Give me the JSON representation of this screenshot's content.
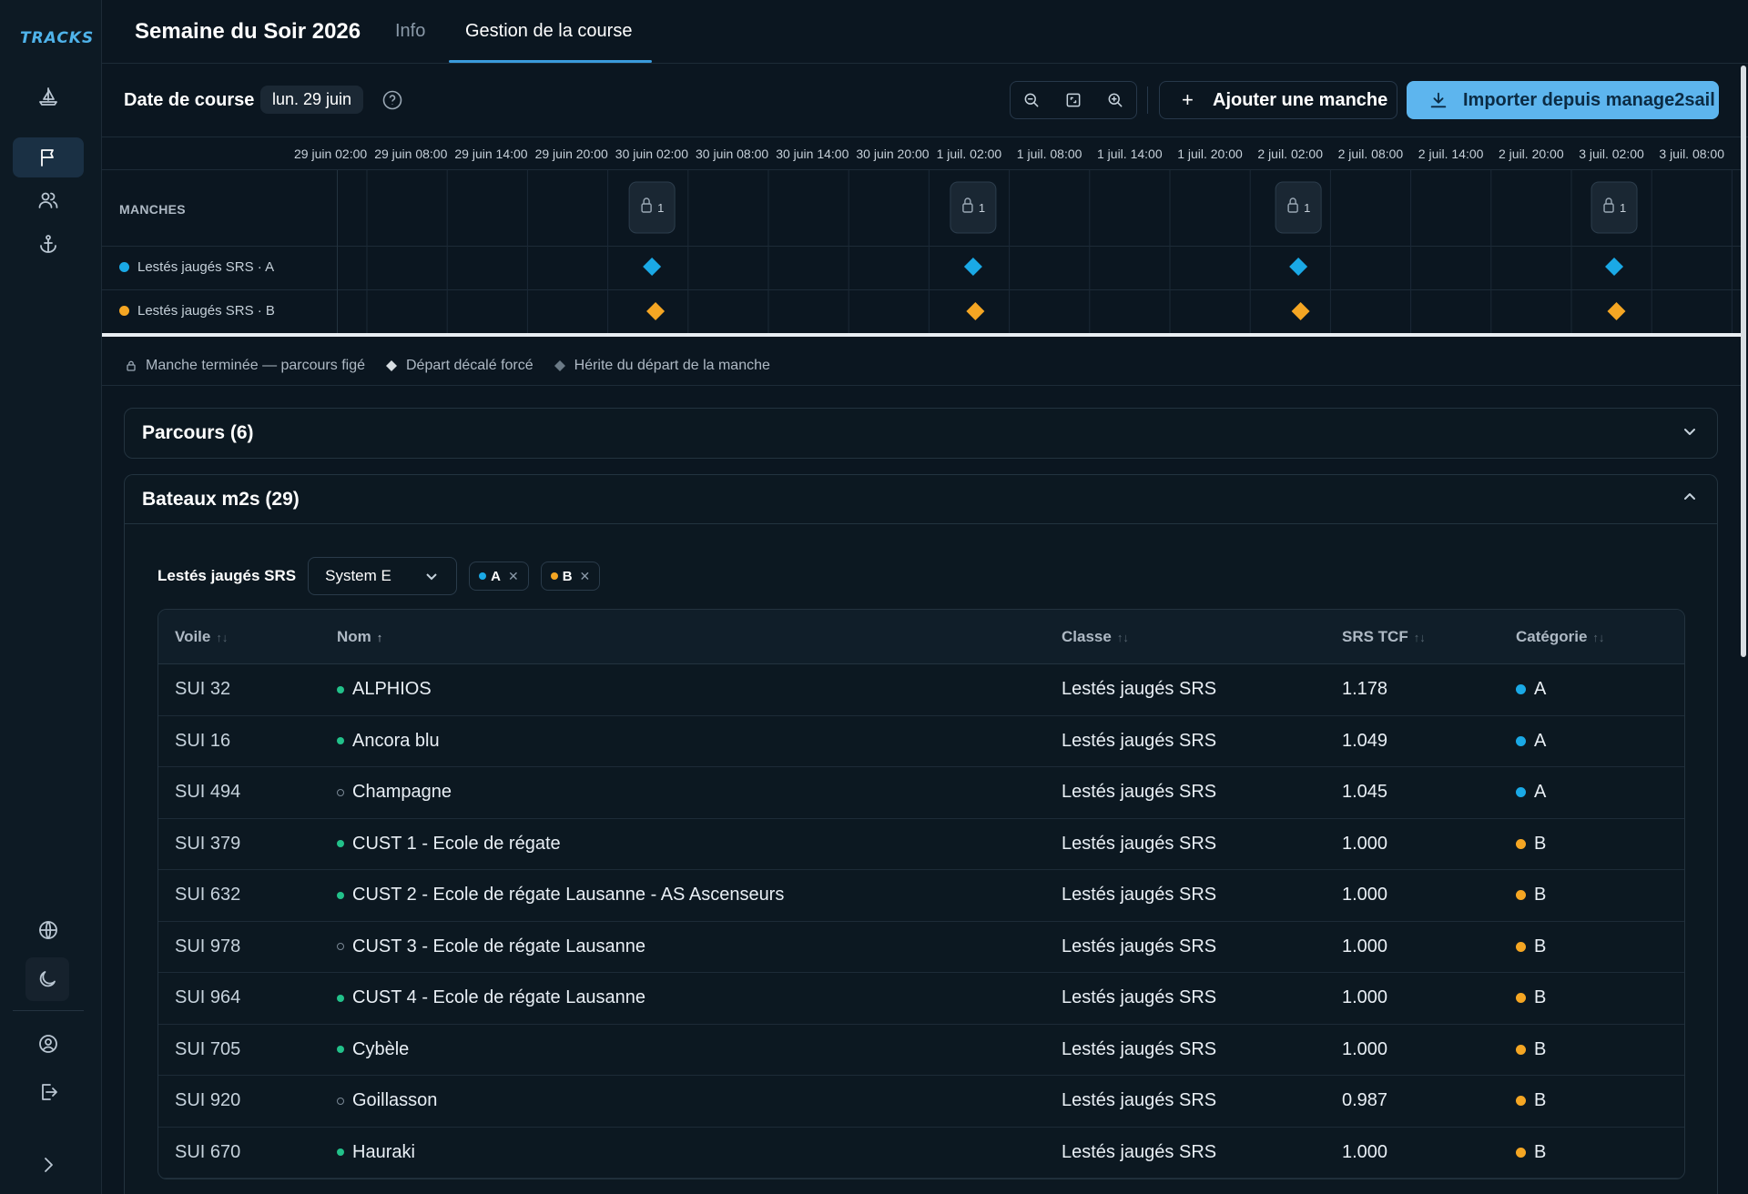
{
  "app": {
    "logo": "TRACKS"
  },
  "sidebar": {
    "items": [
      {
        "icon": "sailboat-icon"
      },
      {
        "icon": "flag-icon",
        "active": true
      },
      {
        "icon": "users-icon"
      },
      {
        "icon": "anchor-icon"
      }
    ],
    "bottom": [
      {
        "icon": "globe-icon"
      },
      {
        "icon": "moon-icon"
      },
      {
        "icon": "user-circle-icon"
      },
      {
        "icon": "logout-icon"
      },
      {
        "icon": "chevron-right-icon"
      }
    ]
  },
  "header": {
    "title": "Semaine du Soir 2026",
    "tabs": [
      {
        "label": "Info",
        "active": false
      },
      {
        "label": "Gestion de la course",
        "active": true
      }
    ]
  },
  "datebar": {
    "label": "Date de course",
    "date": "lun. 29 juin",
    "add_label": "Ajouter une manche",
    "import_label": "Importer depuis manage2sail"
  },
  "timeline": {
    "ticks": [
      "29 juin 02:00",
      "29 juin 08:00",
      "29 juin 14:00",
      "29 juin 20:00",
      "30 juin 02:00",
      "30 juin 08:00",
      "30 juin 14:00",
      "30 juin 20:00",
      "1 juil. 02:00",
      "1 juil. 08:00",
      "1 juil. 14:00",
      "1 juil. 20:00",
      "2 juil. 02:00",
      "2 juil. 08:00",
      "2 juil. 14:00",
      "2 juil. 20:00",
      "3 juil. 02:00",
      "3 juil. 08:00"
    ],
    "manches_label": "MANCHES",
    "race_badges": [
      "1",
      "1",
      "1",
      "1"
    ],
    "rows": [
      {
        "label": "Lestés jaugés SRS · A",
        "color": "#1aa9e6"
      },
      {
        "label": "Lestés jaugés SRS · B",
        "color": "#f5a623"
      }
    ]
  },
  "legend": [
    {
      "icon": "lock-icon",
      "label": "Manche terminée — parcours figé"
    },
    {
      "icon": "diamond-white-icon",
      "label": "Départ décalé forcé"
    },
    {
      "icon": "diamond-gray-icon",
      "label": "Hérite du départ de la manche"
    }
  ],
  "parcours": {
    "title": "Parcours (6)"
  },
  "bateaux": {
    "title": "Bateaux m2s (29)",
    "filter_label": "Lestés jaugés SRS",
    "system": "System E",
    "pills": [
      {
        "label": "A",
        "color": "#1aa9e6"
      },
      {
        "label": "B",
        "color": "#f5a623"
      }
    ],
    "columns": [
      "Voile",
      "Nom",
      "Classe",
      "SRS TCF",
      "Catégorie"
    ],
    "rows": [
      {
        "voile": "SUI 32",
        "nom": "ALPHIOS",
        "active": true,
        "classe": "Lestés jaugés SRS",
        "srs": "1.178",
        "cat": "A"
      },
      {
        "voile": "SUI 16",
        "nom": "Ancora blu",
        "active": true,
        "classe": "Lestés jaugés SRS",
        "srs": "1.049",
        "cat": "A"
      },
      {
        "voile": "SUI 494",
        "nom": "Champagne",
        "active": false,
        "classe": "Lestés jaugés SRS",
        "srs": "1.045",
        "cat": "A"
      },
      {
        "voile": "SUI 379",
        "nom": "CUST 1 - Ecole de régate",
        "active": true,
        "classe": "Lestés jaugés SRS",
        "srs": "1.000",
        "cat": "B"
      },
      {
        "voile": "SUI 632",
        "nom": "CUST 2 - Ecole de régate Lausanne - AS Ascenseurs",
        "active": true,
        "classe": "Lestés jaugés SRS",
        "srs": "1.000",
        "cat": "B"
      },
      {
        "voile": "SUI 978",
        "nom": "CUST 3 - Ecole de régate Lausanne",
        "active": false,
        "classe": "Lestés jaugés SRS",
        "srs": "1.000",
        "cat": "B"
      },
      {
        "voile": "SUI 964",
        "nom": "CUST 4 - Ecole de régate Lausanne",
        "active": true,
        "classe": "Lestés jaugés SRS",
        "srs": "1.000",
        "cat": "B"
      },
      {
        "voile": "SUI 705",
        "nom": "Cybèle",
        "active": true,
        "classe": "Lestés jaugés SRS",
        "srs": "1.000",
        "cat": "B"
      },
      {
        "voile": "SUI 920",
        "nom": "Goillasson",
        "active": false,
        "classe": "Lestés jaugés SRS",
        "srs": "0.987",
        "cat": "B"
      },
      {
        "voile": "SUI 670",
        "nom": "Hauraki",
        "active": true,
        "classe": "Lestés jaugés SRS",
        "srs": "1.000",
        "cat": "B"
      }
    ]
  },
  "colors": {
    "catA": "#1aa9e6",
    "catB": "#f5a623",
    "accent": "#5db5ee"
  }
}
